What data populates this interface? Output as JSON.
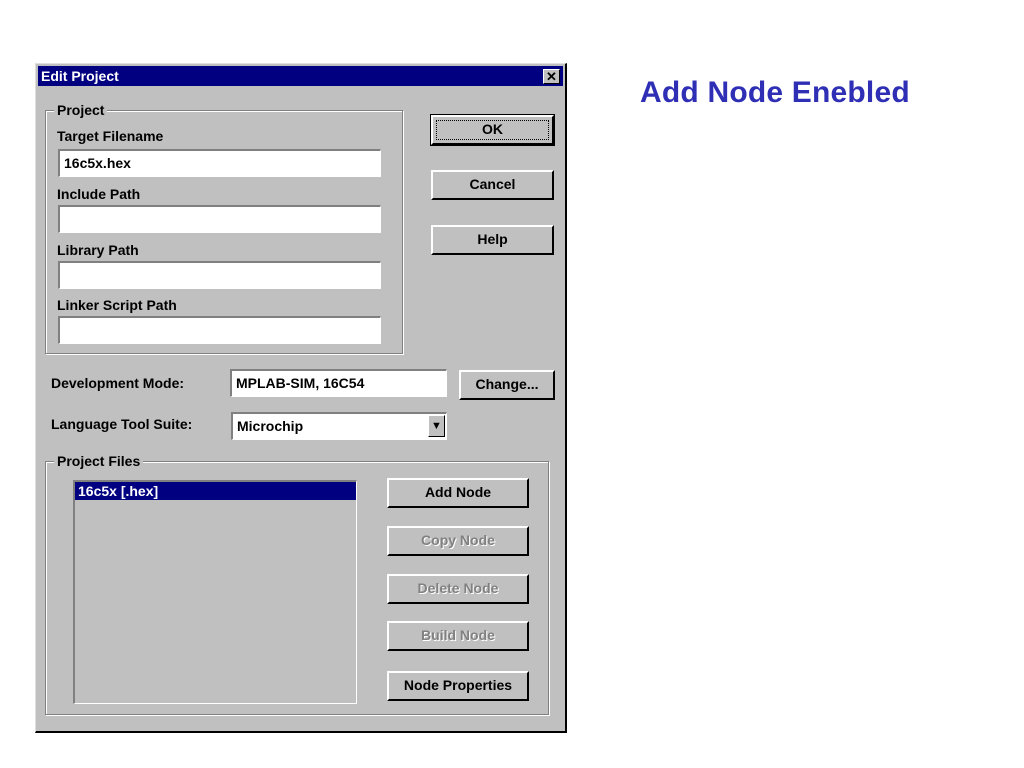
{
  "caption": "Add Node Enebled",
  "dialog": {
    "title": "Edit Project",
    "close_glyph": "✕",
    "project_group": {
      "label": "Project",
      "target_filename": {
        "label": "Target Filename",
        "value": "16c5x.hex"
      },
      "include_path": {
        "label": "Include Path",
        "value": ""
      },
      "library_path": {
        "label": "Library Path",
        "value": ""
      },
      "linker_script_path": {
        "label": "Linker Script Path",
        "value": ""
      }
    },
    "buttons": {
      "ok": "OK",
      "cancel": "Cancel",
      "help": "Help",
      "change": "Change..."
    },
    "development_mode": {
      "label": "Development Mode:",
      "value": "MPLAB-SIM, 16C54"
    },
    "language_tool_suite": {
      "label": "Language Tool Suite:",
      "value": "Microchip"
    },
    "project_files": {
      "label": "Project Files",
      "items": [
        "16c5x [.hex]"
      ],
      "add_node": "Add Node",
      "copy_node": "Copy Node",
      "delete_node": "Delete Node",
      "build_node": "Build Node",
      "node_properties": "Node Properties"
    }
  }
}
